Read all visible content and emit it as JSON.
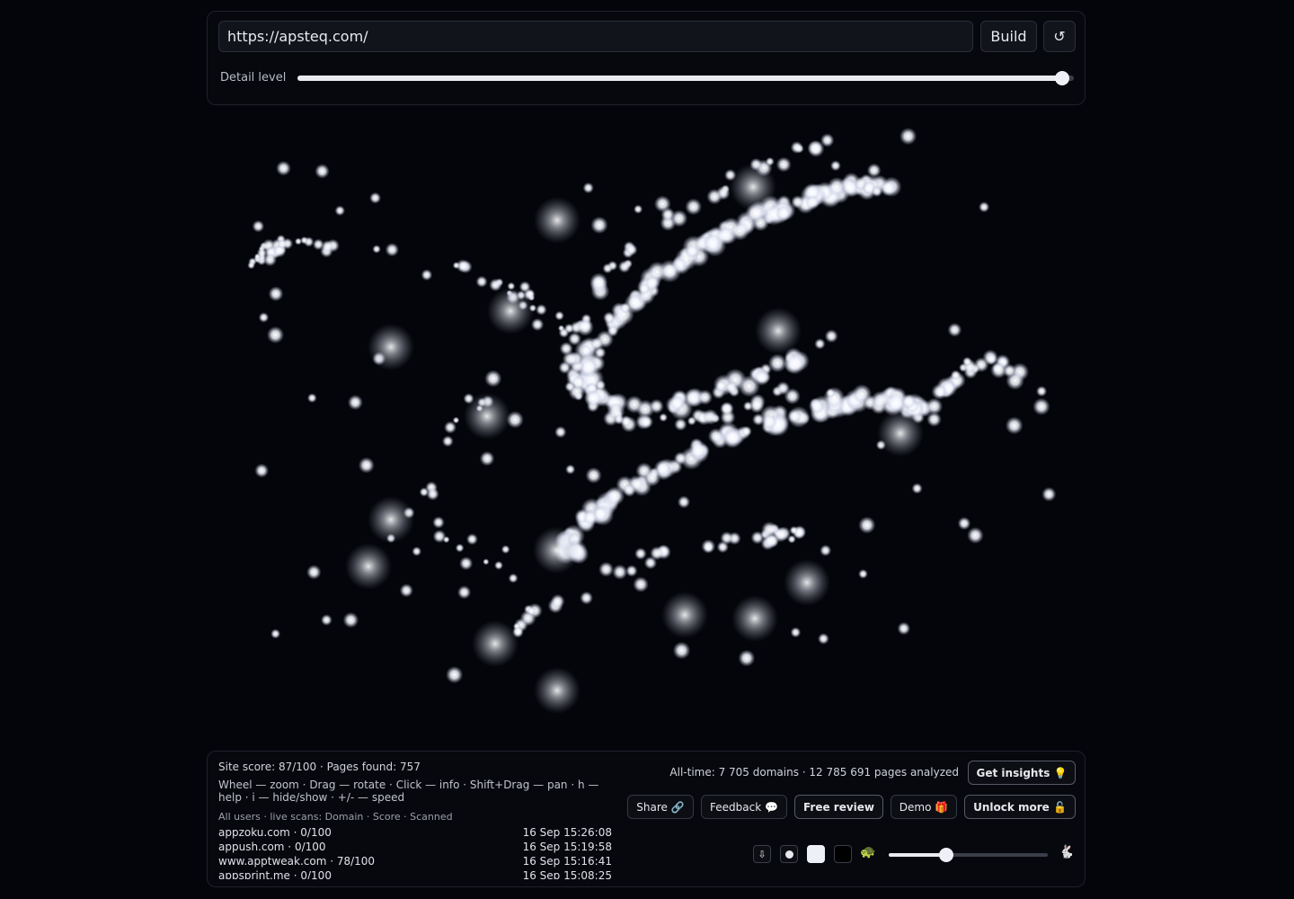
{
  "controls": {
    "url_value": "https://apsteq.com/",
    "build_label": "Build",
    "reset_symbol": "↺",
    "detail_label": "Detail level",
    "detail_value_pct": 98.5
  },
  "footer": {
    "site_stats": "Site score: 87/100 · Pages found: 757",
    "help": "Wheel — zoom · Drag — rotate · Click — info · Shift+Drag — pan · h — help · i — hide/show · +/- — speed",
    "scans_header": "All users · live scans: Domain · Score · Scanned",
    "scans": [
      {
        "domain": "appzoku.com · 0/100",
        "time": "16 Sep 15:26:08"
      },
      {
        "domain": "appush.com · 0/100",
        "time": "16 Sep 15:19:58"
      },
      {
        "domain": "www.apptweak.com · 78/100",
        "time": "16 Sep 15:16:41"
      },
      {
        "domain": "appsprint.me · 0/100",
        "time": "16 Sep 15:08:25"
      }
    ],
    "alltime": "All-time: 7 705 domains · 12 785 691 pages analyzed",
    "buttons": {
      "insights": "Get insights 💡",
      "share": "Share 🔗",
      "feedback": "Feedback 💬",
      "free_review": "Free review",
      "demo": "Demo 🎁",
      "unlock": "Unlock more 🔓"
    },
    "toolbar": {
      "download_symbol": "⇩",
      "slow_symbol": "🐢",
      "fast_symbol": "🐇",
      "speed_value_pct": 36
    }
  },
  "colors": {
    "background": "#04050a",
    "panel_border": "#1e222c",
    "node_glow": "#ffffff"
  }
}
